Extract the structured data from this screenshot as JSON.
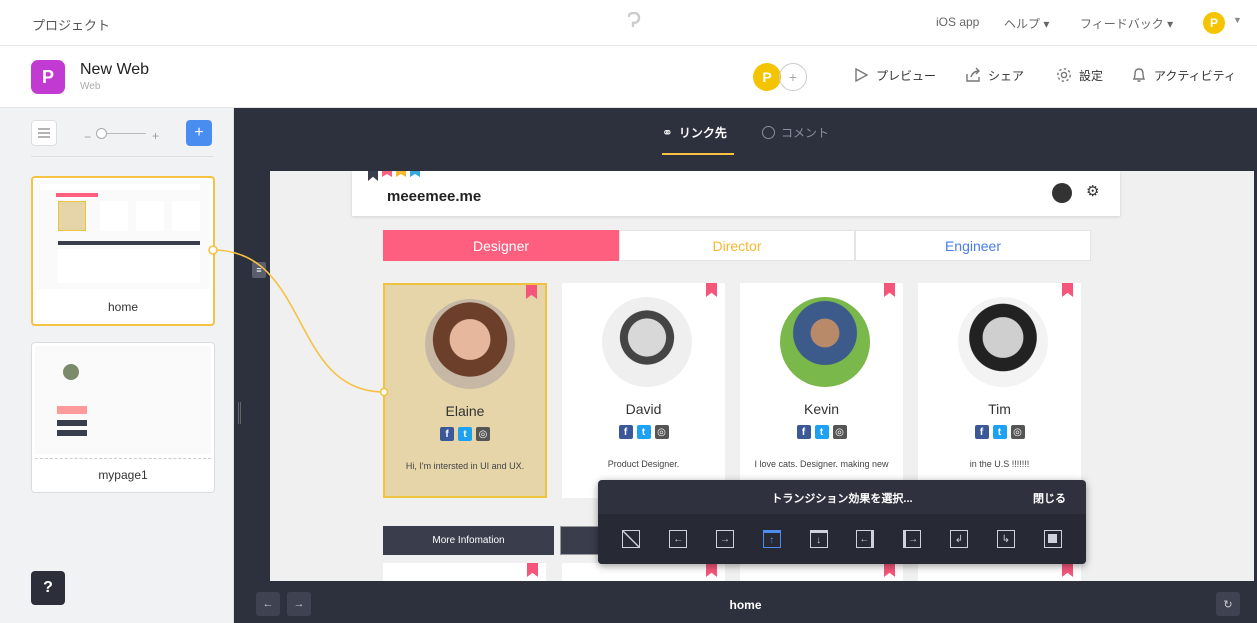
{
  "topnav": {
    "project": "プロジェクト",
    "ios_app": "iOS app",
    "help": "ヘルプ ▾",
    "feedback": "フィードバック ▾",
    "user_initial": "P"
  },
  "project": {
    "logo": "P",
    "title": "New Web",
    "subtitle": "Web",
    "collab_initial": "P",
    "preview": "プレビュー",
    "share": "シェア",
    "settings": "設定",
    "activity": "アクティビティ"
  },
  "sidebar": {
    "pages": [
      {
        "name": "home"
      },
      {
        "name": "mypage1"
      }
    ],
    "help_label": "?"
  },
  "canvas": {
    "tabs": [
      {
        "label": "リンク先",
        "active": true
      },
      {
        "label": "コメント",
        "active": false
      }
    ]
  },
  "site": {
    "logo": "meeemee.me",
    "categories": [
      {
        "label": "Designer",
        "color": "#ff5f7e",
        "text_color": "#ffffff"
      },
      {
        "label": "Director",
        "color": "#ffffff",
        "text_color": "#f5b82e"
      },
      {
        "label": "Engineer",
        "color": "#ffffff",
        "text_color": "#4a7de8"
      }
    ],
    "people": [
      {
        "name": "Elaine",
        "bio": "Hi, I'm intersted in UI and UX."
      },
      {
        "name": "David",
        "bio": "Product Designer."
      },
      {
        "name": "Kevin",
        "bio": "I love cats. Designer. making new"
      },
      {
        "name": "Tim",
        "bio": "in the U.S !!!!!!!"
      }
    ],
    "more_button": "More Infomation"
  },
  "transition": {
    "title": "トランジション効果を選択...",
    "close": "閉じる",
    "icons": [
      "none-icon",
      "slide-left-icon",
      "slide-right-icon",
      "slide-up-icon",
      "slide-down-icon",
      "push-left-icon",
      "push-right-icon",
      "flip-left-icon",
      "flip-right-icon",
      "fade-icon"
    ]
  },
  "bottombar": {
    "page": "home",
    "back": "←",
    "forward": "→"
  },
  "colors": {
    "accent": "#f6c244",
    "dark": "#2d303d",
    "pink": "#ff5f7e"
  }
}
